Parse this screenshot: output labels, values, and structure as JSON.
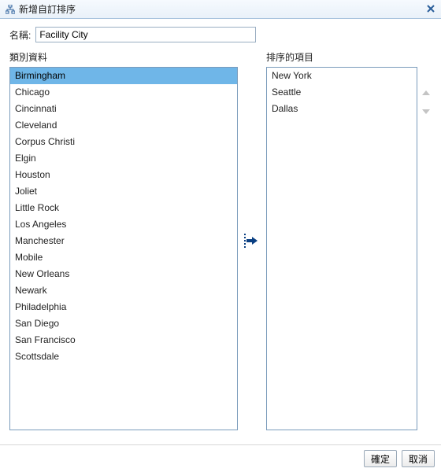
{
  "title": "新增自訂排序",
  "name_field": {
    "label": "名稱:",
    "value": "Facility City"
  },
  "left": {
    "header": "類別資料",
    "selected_index": 0,
    "items": [
      "Birmingham",
      "Chicago",
      "Cincinnati",
      "Cleveland",
      "Corpus Christi",
      "Elgin",
      "Houston",
      "Joliet",
      "Little Rock",
      "Los Angeles",
      "Manchester",
      "Mobile",
      "New Orleans",
      "Newark",
      "Philadelphia",
      "San Diego",
      "San Francisco",
      "Scottsdale"
    ]
  },
  "right": {
    "header": "排序的項目",
    "items": [
      "New York",
      "Seattle",
      "Dallas"
    ]
  },
  "buttons": {
    "ok": "確定",
    "cancel": "取消"
  },
  "icons": {
    "title": "hierarchy-icon",
    "close": "close-icon",
    "move_right": "arrow-right-icon",
    "move_up": "arrow-up-icon",
    "move_down": "arrow-down-icon"
  }
}
